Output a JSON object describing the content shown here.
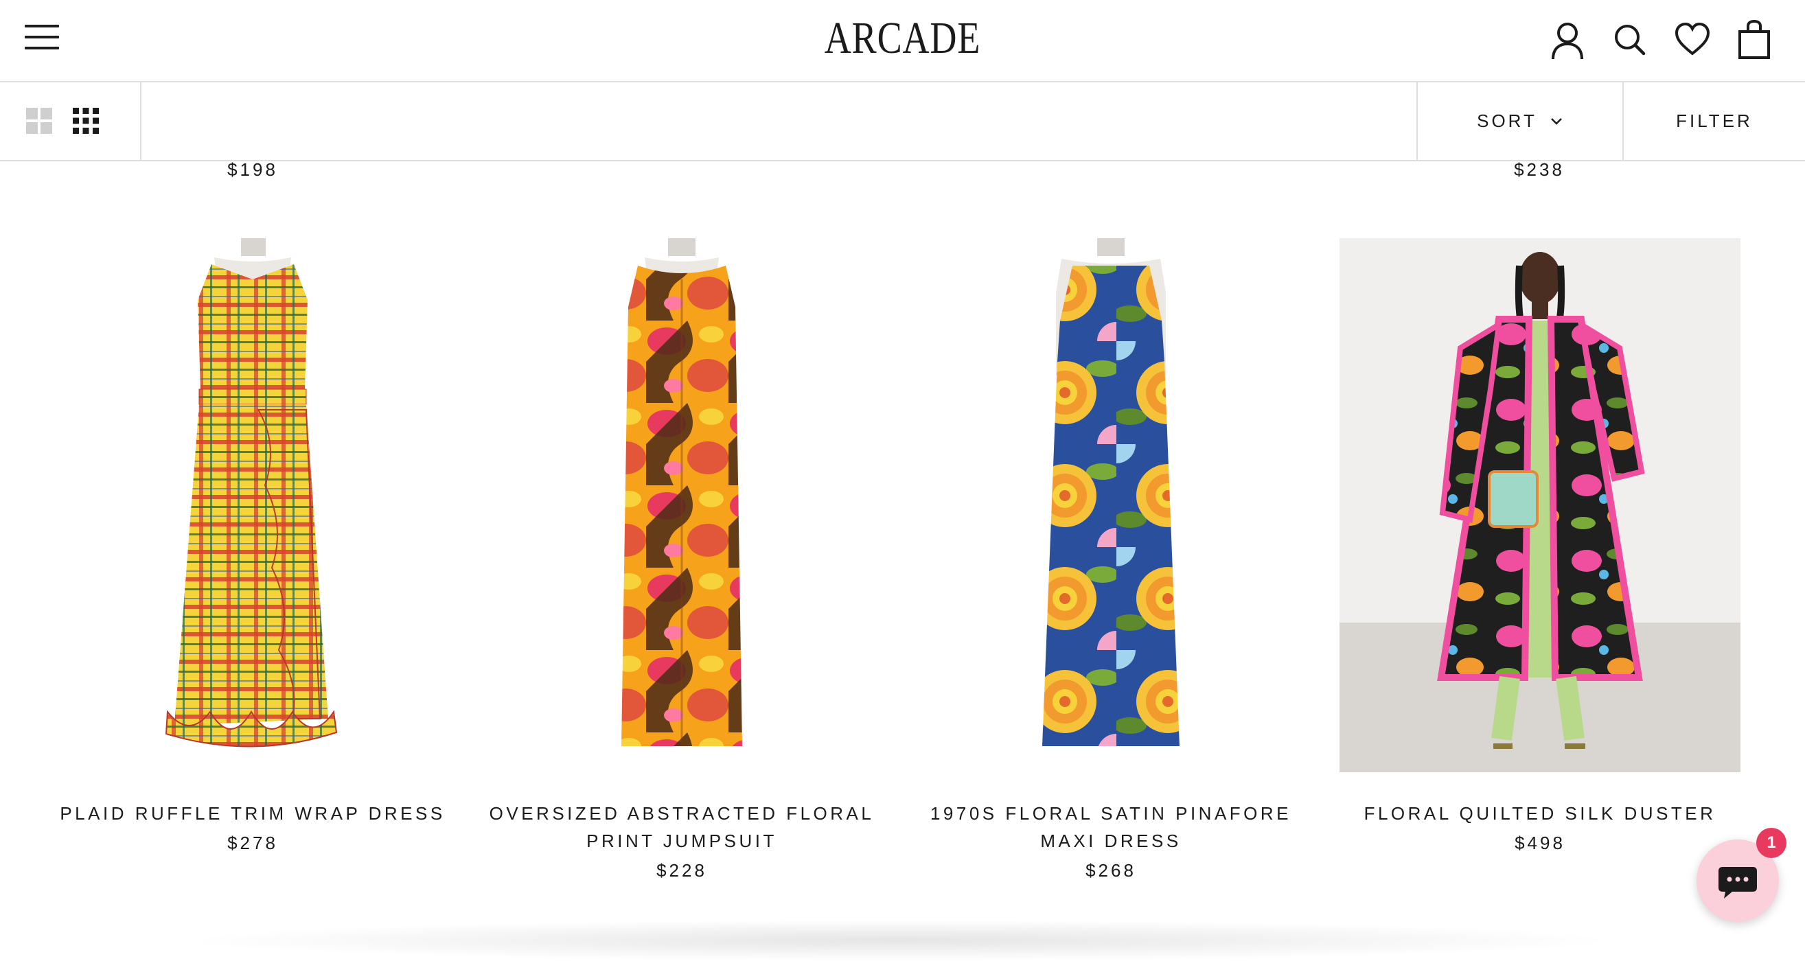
{
  "header": {
    "logo": "ARCADE",
    "icons": [
      "menu-icon",
      "account-icon",
      "search-icon",
      "wishlist-heart-icon",
      "shopping-bag-icon"
    ]
  },
  "toolbar": {
    "layout_options": [
      "grid-2-icon",
      "grid-4-icon"
    ],
    "active_layout": "grid-4-icon",
    "sort_label": "SORT",
    "filter_label": "FILTER"
  },
  "previous_row": {
    "prices": [
      "$198",
      "$238"
    ]
  },
  "products": [
    {
      "title": "PLAID RUFFLE TRIM WRAP DRESS",
      "price": "$278",
      "image_colors": [
        "#f4d43a",
        "#d8412f",
        "#2a6b3f"
      ]
    },
    {
      "title": "OVERSIZED ABSTRACTED FLORAL PRINT JUMPSUIT",
      "price": "$228",
      "image_colors": [
        "#f6a21b",
        "#e83a5e",
        "#4b2a18"
      ]
    },
    {
      "title": "1970S FLORAL SATIN PINAFORE MAXI DRESS",
      "price": "$268",
      "image_colors": [
        "#f5c23a",
        "#5c8a2c",
        "#2a4f9c"
      ]
    },
    {
      "title": "FLORAL QUILTED SILK DUSTER",
      "price": "$498",
      "image_colors": [
        "#ef4f9e",
        "#1f1f1f",
        "#b9d98a"
      ]
    }
  ],
  "chat": {
    "icon": "chat-bubble-icon",
    "badge_count": "1",
    "background_color": "#fbd0da",
    "badge_color": "#e83a5e"
  }
}
